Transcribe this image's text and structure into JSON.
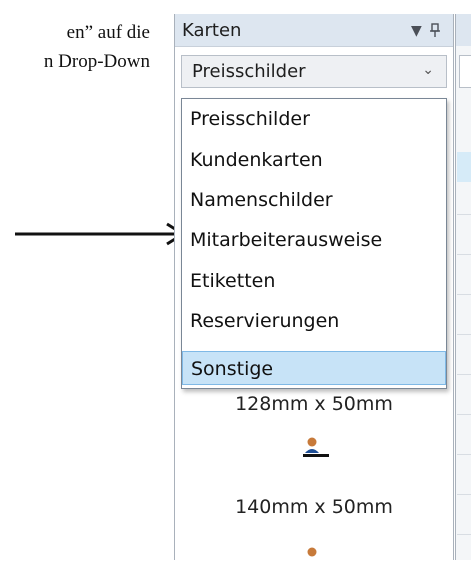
{
  "document": {
    "line1": "en” auf die",
    "line2": "n Drop-Down"
  },
  "panel": {
    "title": "Karten",
    "pin_icon": "pin-icon",
    "menu_icon": "dropdown-triangle-icon",
    "combo": {
      "value": "Preisschilder",
      "arrow_icon": "chevron-down-icon"
    },
    "dropdown": {
      "items": [
        "Preisschilder",
        "Kundenkarten",
        "Namenschilder",
        "Mitarbeiterausweise",
        "Etiketten",
        "Reservierungen",
        "Sonstige"
      ],
      "selected": "Sonstige"
    },
    "cards": [
      {
        "label": "128mm x 50mm"
      },
      {
        "label": "140mm x 50mm"
      }
    ]
  },
  "colors": {
    "header_bg": "#dde6f0",
    "selected_bg": "#c7e3f7",
    "selected_border": "#7fb9e6"
  }
}
